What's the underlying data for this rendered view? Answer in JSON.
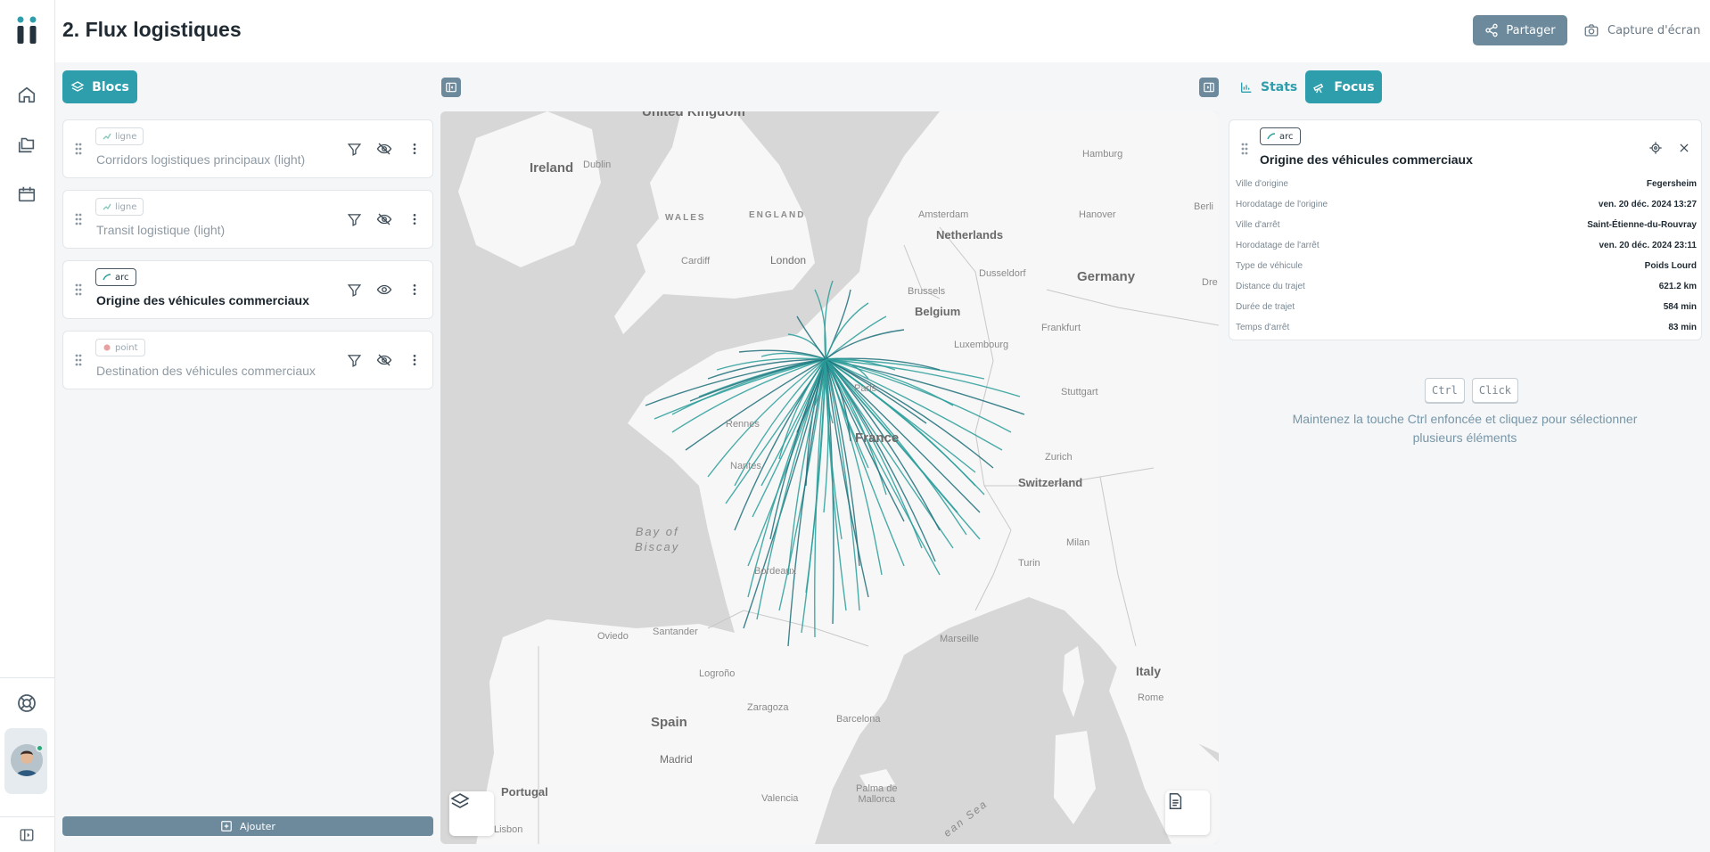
{
  "app": {
    "brand_color": "#2f9eac",
    "accent_gray": "#6d8a9c"
  },
  "header": {
    "title": "2. Flux logistiques",
    "share_label": "Partager",
    "capture_label": "Capture d'écran"
  },
  "nav": {
    "items": [
      {
        "icon": "home-icon"
      },
      {
        "icon": "folders-icon"
      },
      {
        "icon": "calendar-icon"
      }
    ],
    "help_icon": "lifebuoy-icon",
    "collapse_icon": "sidebar-toggle-icon"
  },
  "left_panel": {
    "blocs_label": "Blocs",
    "layers": [
      {
        "type": "ligne",
        "name": "Corridors logistiques principaux (light)",
        "visible": false,
        "active": false
      },
      {
        "type": "ligne",
        "name": "Transit logistique (light)",
        "visible": false,
        "active": false
      },
      {
        "type": "arc",
        "name": "Origine des véhicules commerciaux",
        "visible": true,
        "active": true
      },
      {
        "type": "point",
        "name": "Destination des véhicules commerciaux",
        "visible": false,
        "active": false
      }
    ],
    "add_label": "Ajouter"
  },
  "map": {
    "labels": {
      "uk": "United Kingdom",
      "ireland": "Ireland",
      "dublin": "Dublin",
      "wales": "WALES",
      "england": "ENGLAND",
      "cardiff": "Cardiff",
      "london": "London",
      "amsterdam": "Amsterdam",
      "netherlands": "Netherlands",
      "hamburg": "Hamburg",
      "hanover": "Hanover",
      "berlin": "Berli",
      "brussels": "Brussels",
      "belgium": "Belgium",
      "dusseldorf": "Dusseldorf",
      "germany": "Germany",
      "dresden": "Dre",
      "frankfurt": "Frankfurt",
      "luxembourg": "Luxembourg",
      "paris": "Paris",
      "rennes": "Rennes",
      "france": "France",
      "stuttgart": "Stuttgart",
      "nantes": "Nantes",
      "zurich": "Zurich",
      "switzerland": "Switzerland",
      "biscay_1": "Bay of",
      "biscay_2": "Biscay",
      "bordeaux": "Bordeaux",
      "milan": "Milan",
      "turin": "Turin",
      "oviedo": "Oviedo",
      "santander": "Santander",
      "marseille": "Marseille",
      "logrono": "Logroño",
      "zaragoza": "Zaragoza",
      "barcelona": "Barcelona",
      "spain": "Spain",
      "italy": "Italy",
      "rome": "Rome",
      "madrid": "Madrid",
      "portugal": "Portugal",
      "lisbon": "Lisbon",
      "valencia": "Valencia",
      "palma_1": "Palma de",
      "palma_2": "Mallorca",
      "sea": "ean Sea"
    },
    "arc_color": "#2a9d9a",
    "layers_icon": "layers-icon",
    "legend_icon": "document-icon"
  },
  "right_panel": {
    "stats_label": "Stats",
    "focus_label": "Focus",
    "focus": {
      "type": "arc",
      "title": "Origine des véhicules commerciaux",
      "attributes": [
        {
          "key": "Ville d'origine",
          "value": "Fegersheim"
        },
        {
          "key": "Horodatage de l'origine",
          "value": "ven. 20 déc. 2024 13:27"
        },
        {
          "key": "Ville d'arrêt",
          "value": "Saint-Étienne-du-Rouvray"
        },
        {
          "key": "Horodatage de l'arrêt",
          "value": "ven. 20 déc. 2024 23:11"
        },
        {
          "key": "Type de véhicule",
          "value": "Poids Lourd"
        },
        {
          "key": "Distance du trajet",
          "value": "621.2 km"
        },
        {
          "key": "Durée de trajet",
          "value": "584 min"
        },
        {
          "key": "Temps d'arrêt",
          "value": "83 min"
        }
      ]
    },
    "kbd_ctrl": "Ctrl",
    "kbd_click": "Click",
    "hint": "Maintenez la touche Ctrl enfoncée et cliquez pour sélectionner plusieurs éléments"
  }
}
